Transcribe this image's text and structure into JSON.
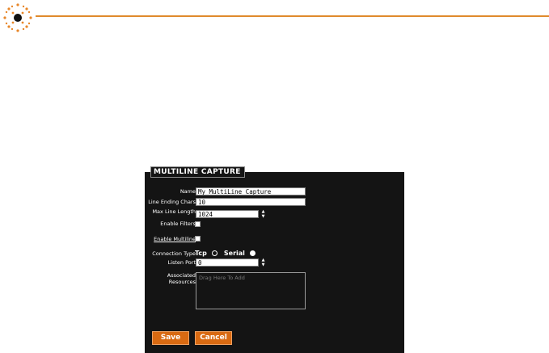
{
  "panel": {
    "title": "Multiline Capture"
  },
  "form": {
    "name_label": "Name",
    "name_value": "My MultiLine Capture",
    "line_ending_label": "Line Ending Chars",
    "line_ending_value": "10",
    "max_line_label": "Max Line Length",
    "max_line_value": "1024",
    "enable_filters_label": "Enable Filters",
    "enable_filters_checked": false,
    "enable_multiline_label": "Enable Multiline",
    "enable_multiline_checked": false,
    "connection_type_label": "Connection Type",
    "conn_tcp_label": "Tcp",
    "conn_serial_label": "Serial",
    "listen_port_label": "Listen Port",
    "listen_port_value": "0",
    "assoc_label": "Associated Resources",
    "assoc_placeholder": "Drag Here To Add"
  },
  "buttons": {
    "save": "Save",
    "cancel": "Cancel"
  },
  "colors": {
    "accent": "#d96a12",
    "line": "#e08a2c",
    "panel_bg": "#141414"
  }
}
